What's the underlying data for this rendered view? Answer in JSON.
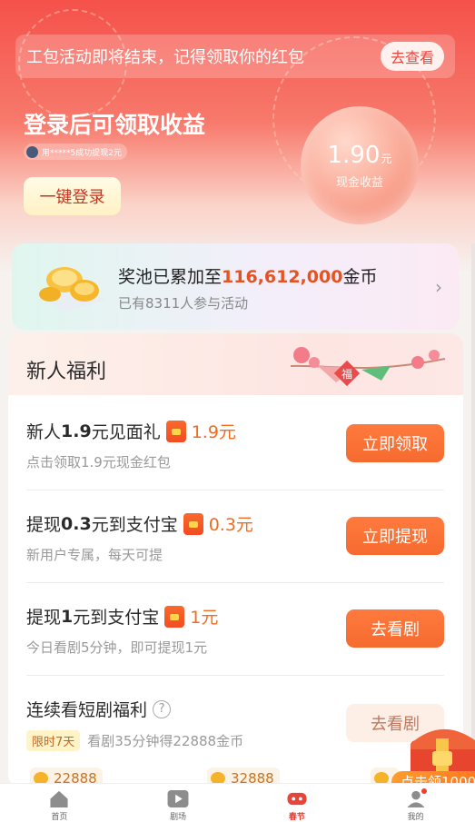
{
  "notice": {
    "text": "工包活动即将结束，记得领取你的红包",
    "button": "去查看"
  },
  "hero": {
    "title": "登录后可领取收益",
    "ticker": "用*****5成功提现2元",
    "login_button": "一键登录",
    "cash_amount": "1.90",
    "cash_unit": "元",
    "cash_label": "现金收益"
  },
  "pool": {
    "title_prefix": "奖池已累加至",
    "title_number": "116,612,000",
    "title_suffix": "金币",
    "subtitle": "已有8311人参与活动"
  },
  "welfare": {
    "title": "新人福利",
    "deco_char": "福",
    "tasks": [
      {
        "title_pre": "新人",
        "title_bold": "1.9",
        "title_post": "元见面礼",
        "reward": "1.9元",
        "desc": "点击领取1.9元现金红包",
        "button": "立即领取"
      },
      {
        "title_pre": "提现",
        "title_bold": "0.3",
        "title_post": "元到支付宝",
        "reward": "0.3元",
        "desc": "新用户专属，每天可提",
        "button": "立即提现"
      },
      {
        "title_pre": "提现",
        "title_bold": "1",
        "title_post": "元到支付宝",
        "reward": "1元",
        "desc": "今日看剧5分钟，即可提现1元",
        "button": "去看剧"
      }
    ],
    "series_task": {
      "title": "连续看短剧福利",
      "tag": "限时7天",
      "desc": "看剧35分钟得22888金币",
      "button": "去看剧",
      "help": "?"
    },
    "coins": [
      "22888",
      "32888",
      ""
    ]
  },
  "chest": {
    "ribbon": "点击领1000"
  },
  "tabbar": {
    "items": [
      {
        "label": "首页"
      },
      {
        "label": "剧场"
      },
      {
        "label": "春节"
      },
      {
        "label": "我的"
      }
    ]
  },
  "colors": {
    "accent": "#f66a2f",
    "hero_red": "#f5514a",
    "reward_orange": "#f26b1d"
  }
}
